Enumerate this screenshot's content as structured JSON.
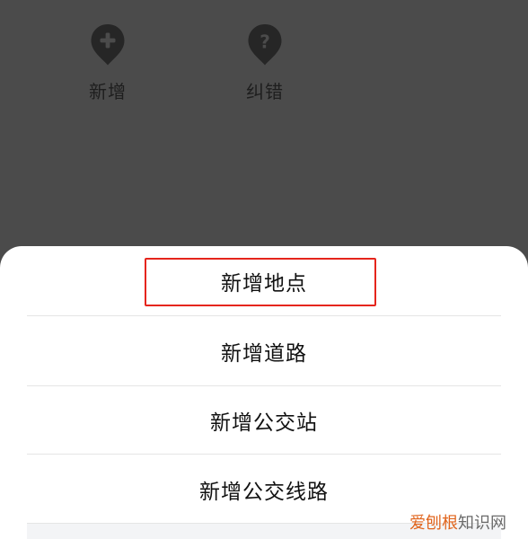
{
  "quick_actions": [
    {
      "label": "新增",
      "icon": "add-location-pin-icon"
    },
    {
      "label": "纠错",
      "icon": "help-location-pin-icon"
    }
  ],
  "sheet": {
    "items": [
      {
        "label": "新增地点",
        "highlighted": true
      },
      {
        "label": "新增道路"
      },
      {
        "label": "新增公交站"
      },
      {
        "label": "新增公交线路"
      }
    ]
  },
  "watermark": {
    "part1": "爱刨根",
    "part2": "知识网"
  },
  "colors": {
    "overlay": "#4b4b4b",
    "pin": "#262626",
    "highlight": "#e5251c",
    "sheet": "#ffffff",
    "watermark_orange": "#e0641c"
  }
}
